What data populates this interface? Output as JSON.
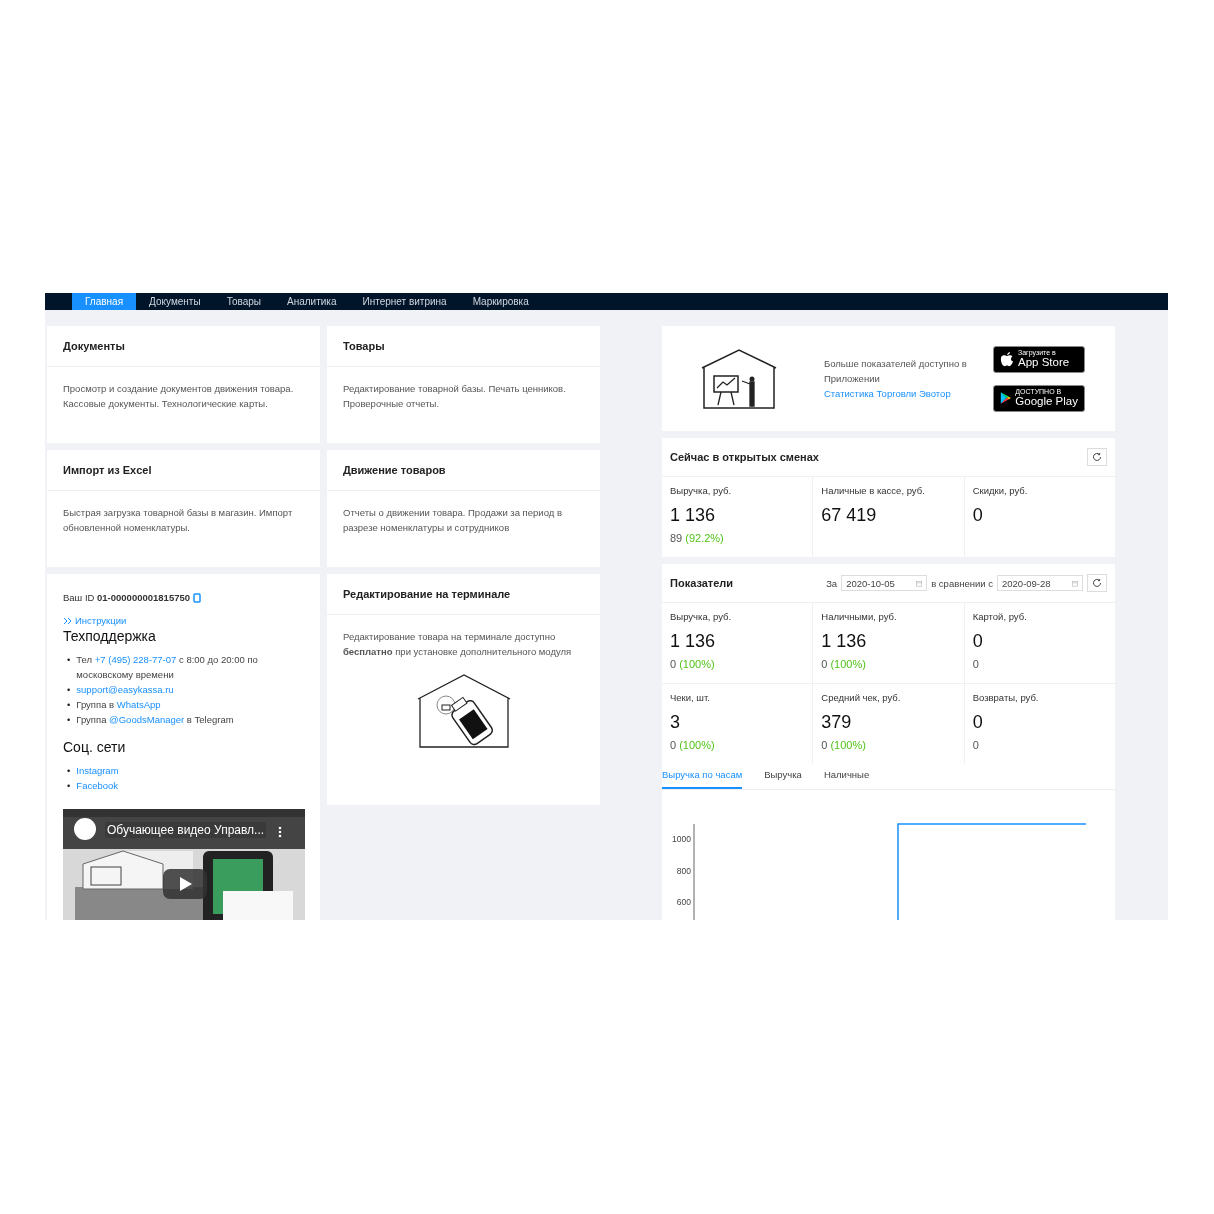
{
  "nav": [
    {
      "label": "Главная",
      "selected": true
    },
    {
      "label": "Документы",
      "selected": false
    },
    {
      "label": "Товары",
      "selected": false
    },
    {
      "label": "Аналитика",
      "selected": false
    },
    {
      "label": "Интернет витрина",
      "selected": false
    },
    {
      "label": "Маркировка",
      "selected": false
    }
  ],
  "cards_left": [
    {
      "title": "Документы",
      "text": "Просмотр и создание документов движения товара. Кассовые документы. Технологические карты."
    },
    {
      "title": "Импорт из Excel",
      "text": "Быстрая загрузка товарной базы в магазин. Импорт обновленной номенклатуры."
    }
  ],
  "cards_mid": [
    {
      "title": "Товары",
      "text": "Редактирование товарной базы. Печать ценников. Проверочные отчеты."
    },
    {
      "title": "Движение товаров",
      "text": "Отчеты о движении товара. Продажи за период в разрезе номенклатуры и сотрудников"
    }
  ],
  "support": {
    "id_label": "Ваш ID",
    "id_value": "01-000000001815750",
    "instructions": "Инструкции",
    "title": "Техподдержка",
    "bullet": "•",
    "items": [
      [
        {
          "text": "Тел "
        },
        {
          "link": "+7 (495) 228-77-07"
        },
        {
          "text": " с 8:00 до 20:00 по московскому времени"
        }
      ],
      [
        {
          "link": "support@easykassa.ru"
        }
      ],
      [
        {
          "text": "Группа в "
        },
        {
          "link": "WhatsApp"
        }
      ],
      [
        {
          "text": "Группа "
        },
        {
          "link": "@GoodsManager"
        },
        {
          "text": " в Telegram"
        }
      ]
    ],
    "social_title": "Соц. сети",
    "social": [
      "Instagram",
      "Facebook"
    ],
    "video": {
      "kind": "picture",
      "title": "Обучающее видео Управл..."
    }
  },
  "terminal_card": {
    "title": "Редактирование на терминале",
    "text": "Редактирование товара на терминале доступно **бесплатно** при установке дополнительного модуля"
  },
  "promo": {
    "text": "Больше показателей доступно в Приложении ",
    "link": "Статистика Торговли Эвотор",
    "stores": [
      {
        "kind": "apple",
        "small": "Загрузите в",
        "big": "App Store"
      },
      {
        "kind": "google",
        "small": "ДОСТУПНО В",
        "big": "Google Play"
      }
    ]
  },
  "open_shifts": {
    "title": "Сейчас в открытых сменах",
    "stats": [
      {
        "label": "Выручка, руб.",
        "value": "1 136",
        "sub": "89",
        "percent": "(92.2%)"
      },
      {
        "label": "Наличные в кассе, руб.",
        "value": "67 419"
      },
      {
        "label": "Скидки, руб.",
        "value": "0"
      }
    ]
  },
  "indicators": {
    "title": "Показатели",
    "for_label": "За",
    "date": "2020-10-05",
    "compare_label": "в сравнении с",
    "compare_date": "2020-09-28",
    "stats": [
      {
        "label": "Выручка, руб.",
        "value": "1 136",
        "sub": "0",
        "percent": "(100%)"
      },
      {
        "label": "Наличными, руб.",
        "value": "1 136",
        "sub": "0",
        "percent": "(100%)"
      },
      {
        "label": "Картой, руб.",
        "value": "0",
        "sub": "0"
      },
      {
        "label": "Чеки, шт.",
        "value": "3",
        "sub": "0",
        "percent": "(100%)"
      },
      {
        "label": "Средний чек, руб.",
        "value": "379",
        "sub": "0",
        "percent": "(100%)"
      },
      {
        "label": "Возвраты, руб.",
        "value": "0",
        "sub": "0"
      }
    ],
    "tabs": [
      {
        "label": "Выручка по часам",
        "selected": true
      },
      {
        "label": "Выручка",
        "selected": false
      },
      {
        "label": "Наличные",
        "selected": false
      }
    ],
    "hourly_chart": {
      "y_labels": [
        "1000",
        "800",
        "600"
      ]
    }
  }
}
